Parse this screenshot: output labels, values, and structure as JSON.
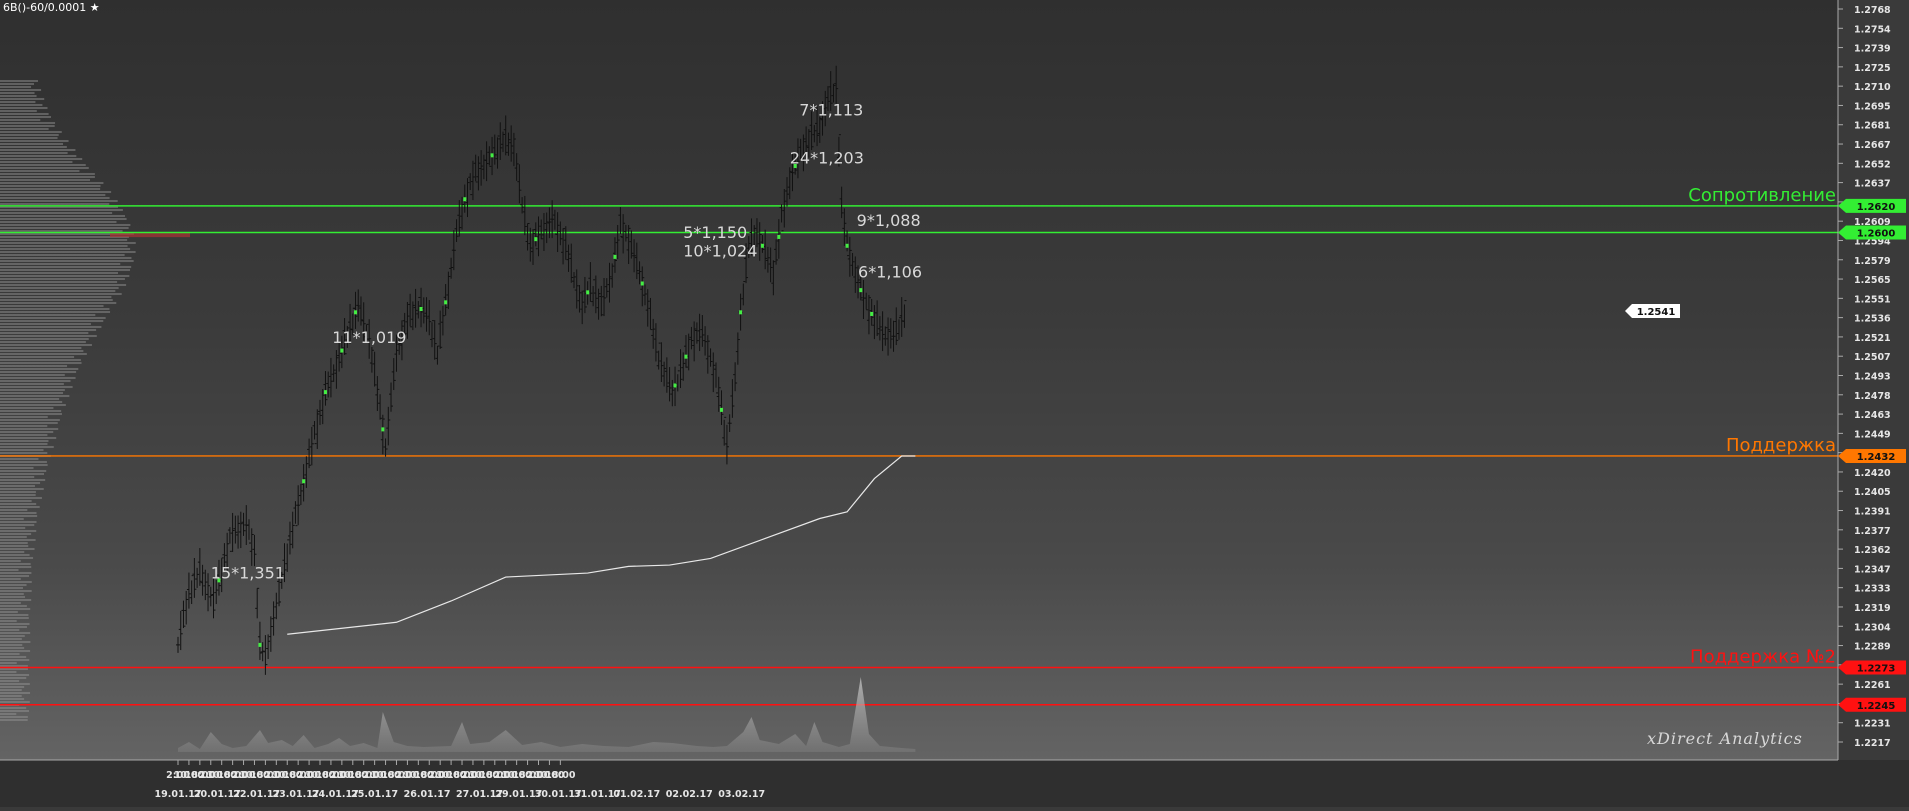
{
  "header": {
    "symbol": "6B()-60/0.0001",
    "favorite_icon": "star-icon"
  },
  "watermark": "xDirect Analytics",
  "price_axis": {
    "ticks": [
      "1.2768",
      "1.2754",
      "1.2739",
      "1.2725",
      "1.2710",
      "1.2695",
      "1.2681",
      "1.2667",
      "1.2652",
      "1.2637",
      "1.2623",
      "1.2609",
      "1.2594",
      "1.2579",
      "1.2565",
      "1.2551",
      "1.2536",
      "1.2521",
      "1.2507",
      "1.2493",
      "1.2478",
      "1.2463",
      "1.2449",
      "1.2435",
      "1.2420",
      "1.2405",
      "1.2391",
      "1.2377",
      "1.2362",
      "1.2347",
      "1.2333",
      "1.2319",
      "1.2304",
      "1.2289",
      "1.2275",
      "1.2261",
      "1.2246",
      "1.2231",
      "1.2217"
    ],
    "current_price": "1.2541"
  },
  "time_axis": {
    "hour_ticks": [
      "2:00",
      "10:00",
      "18:00",
      "2:00",
      "10:00",
      "18:00",
      "2:00",
      "10:00",
      "18:00",
      "2:00",
      "10:00",
      "18:00",
      "2:00",
      "10:00",
      "18:00",
      "2:00",
      "10:00",
      "18:00",
      "2:00",
      "10:00",
      "18:00",
      "2:00",
      "10:00",
      "18:00",
      "2:00",
      "10:00",
      "18:00",
      "2:00",
      "10:00",
      "18:00",
      "2:00",
      "10:00",
      "18:00",
      "2:00",
      "10:00",
      "18:00"
    ],
    "date_labels": [
      "19.01.17",
      "20.01.17",
      "22.01.17",
      "23.01.17",
      "24.01.17",
      "25.01.17",
      "26.01.17",
      "27.01.17",
      "29.01.17",
      "30.01.17",
      "31.01.17",
      "01.02.17",
      "02.02.17",
      "03.02.17"
    ]
  },
  "levels": [
    {
      "name": "Сопротивление",
      "price": "1.2620",
      "color": "#33ee33"
    },
    {
      "name": "",
      "price": "1.2600",
      "color": "#33ee33"
    },
    {
      "name": "Поддержка",
      "price": "1.2432",
      "color": "#ff7700"
    },
    {
      "name": "Поддержка №2",
      "price": "1.2273",
      "color": "#ff1111"
    },
    {
      "name": "",
      "price": "1.2245",
      "color": "#ff1111"
    }
  ],
  "annotations": [
    {
      "text": "15*1,351",
      "price": 1.234,
      "time_hours": 24
    },
    {
      "text": "11*1,019",
      "price": 1.2517,
      "time_hours": 113
    },
    {
      "text": "7*1,113",
      "price": 1.2688,
      "time_hours": 455
    },
    {
      "text": "24*1,203",
      "price": 1.2652,
      "time_hours": 448
    },
    {
      "text": "5*1,150",
      "price": 1.2596,
      "time_hours": 370
    },
    {
      "text": "10*1,024",
      "price": 1.2582,
      "time_hours": 370
    },
    {
      "text": "9*1,088",
      "price": 1.2605,
      "time_hours": 497
    },
    {
      "text": "6*1,106",
      "price": 1.2566,
      "time_hours": 498
    }
  ],
  "colors": {
    "background": "#3a3a3a",
    "bar": "#111111",
    "signal": "#44ee44",
    "moving_average": "#e8e8e8",
    "text": "#dddddd"
  },
  "chart_data": {
    "type": "ohlc",
    "title": "6B()-60/0.0001",
    "x_unit": "hours since 19.01.17 00:00",
    "ylim": [
      1.221,
      1.2775
    ],
    "grid": false,
    "price_path": [
      [
        0,
        1.229
      ],
      [
        8,
        1.233
      ],
      [
        16,
        1.2345
      ],
      [
        26,
        1.2322
      ],
      [
        34,
        1.2355
      ],
      [
        40,
        1.2375
      ],
      [
        50,
        1.238
      ],
      [
        56,
        1.236
      ],
      [
        60,
        1.229
      ],
      [
        64,
        1.228
      ],
      [
        70,
        1.231
      ],
      [
        80,
        1.236
      ],
      [
        88,
        1.2395
      ],
      [
        98,
        1.244
      ],
      [
        108,
        1.248
      ],
      [
        118,
        1.2505
      ],
      [
        126,
        1.253
      ],
      [
        132,
        1.2545
      ],
      [
        140,
        1.252
      ],
      [
        146,
        1.248
      ],
      [
        152,
        1.2438
      ],
      [
        160,
        1.251
      ],
      [
        168,
        1.2535
      ],
      [
        176,
        1.2545
      ],
      [
        184,
        1.2535
      ],
      [
        190,
        1.251
      ],
      [
        198,
        1.256
      ],
      [
        204,
        1.26
      ],
      [
        210,
        1.2625
      ],
      [
        218,
        1.2645
      ],
      [
        228,
        1.2655
      ],
      [
        238,
        1.267
      ],
      [
        246,
        1.2665
      ],
      [
        252,
        1.262
      ],
      [
        258,
        1.259
      ],
      [
        266,
        1.26
      ],
      [
        274,
        1.261
      ],
      [
        284,
        1.259
      ],
      [
        290,
        1.2565
      ],
      [
        296,
        1.2545
      ],
      [
        302,
        1.256
      ],
      [
        310,
        1.2545
      ],
      [
        318,
        1.257
      ],
      [
        324,
        1.2605
      ],
      [
        330,
        1.2595
      ],
      [
        338,
        1.257
      ],
      [
        344,
        1.2545
      ],
      [
        350,
        1.2515
      ],
      [
        356,
        1.2495
      ],
      [
        362,
        1.248
      ],
      [
        370,
        1.25
      ],
      [
        376,
        1.252
      ],
      [
        384,
        1.2525
      ],
      [
        390,
        1.2505
      ],
      [
        396,
        1.248
      ],
      [
        402,
        1.244
      ],
      [
        408,
        1.249
      ],
      [
        412,
        1.254
      ],
      [
        418,
        1.259
      ],
      [
        424,
        1.26
      ],
      [
        430,
        1.2585
      ],
      [
        436,
        1.257
      ],
      [
        442,
        1.261
      ],
      [
        448,
        1.264
      ],
      [
        456,
        1.266
      ],
      [
        462,
        1.267
      ],
      [
        470,
        1.268
      ],
      [
        476,
        1.27
      ],
      [
        482,
        1.271
      ],
      [
        486,
        1.262
      ],
      [
        490,
        1.259
      ],
      [
        496,
        1.257
      ],
      [
        502,
        1.255
      ],
      [
        510,
        1.2535
      ],
      [
        516,
        1.2525
      ],
      [
        524,
        1.2522
      ],
      [
        528,
        1.253
      ],
      [
        532,
        1.2541
      ]
    ],
    "signal_hours": [
      30,
      60,
      92,
      108,
      120,
      130,
      150,
      178,
      196,
      210,
      230,
      262,
      300,
      320,
      340,
      364,
      372,
      398,
      412,
      428,
      440,
      452,
      490,
      500,
      508
    ],
    "moving_average": [
      [
        80,
        1.2298
      ],
      [
        160,
        1.2307
      ],
      [
        200,
        1.2323
      ],
      [
        240,
        1.2341
      ],
      [
        300,
        1.2344
      ],
      [
        330,
        1.2349
      ],
      [
        360,
        1.235
      ],
      [
        390,
        1.2355
      ],
      [
        430,
        1.237
      ],
      [
        470,
        1.2385
      ],
      [
        490,
        1.239
      ],
      [
        510,
        1.2415
      ],
      [
        530,
        1.2432
      ],
      [
        540,
        1.2432
      ]
    ],
    "volume_profile_peak_price": 1.2598
  }
}
